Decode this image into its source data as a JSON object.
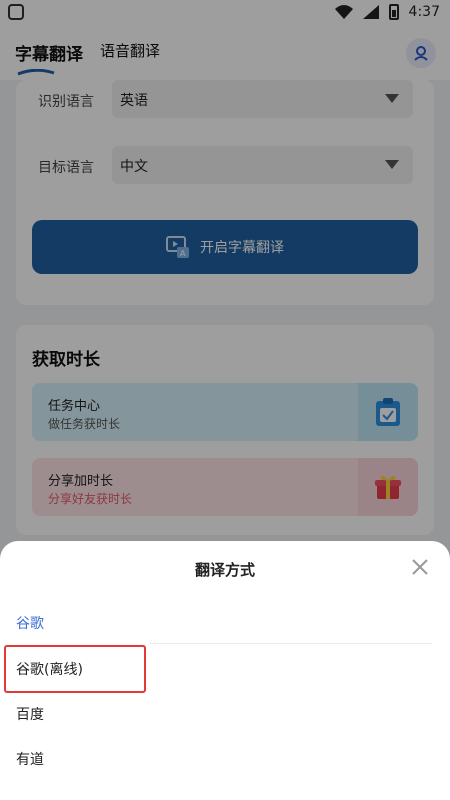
{
  "status_bar": {
    "time": "4:37"
  },
  "top_bar": {
    "tabs": [
      {
        "label": "字幕翻译",
        "active": true
      },
      {
        "label": "语音翻译",
        "active": false
      }
    ],
    "accent_color": "#1f5fa0"
  },
  "translate_card": {
    "source_label": "识别语言",
    "source_value": "英语",
    "target_label": "目标语言",
    "target_value": "中文",
    "start_button_label": "开启字幕翻译"
  },
  "duration_card": {
    "title": "获取时长",
    "items": [
      {
        "title": "任务中心",
        "subtitle": "做任务获时长",
        "icon": "task-clipboard-icon"
      },
      {
        "title": "分享加时长",
        "subtitle": "分享好友获时长",
        "icon": "gift-icon"
      }
    ]
  },
  "sheet": {
    "title": "翻译方式",
    "options": [
      {
        "label": "谷歌",
        "selected": true
      },
      {
        "label": "谷歌(离线)",
        "selected": false
      },
      {
        "label": "百度",
        "selected": false
      },
      {
        "label": "有道",
        "selected": false
      }
    ]
  }
}
